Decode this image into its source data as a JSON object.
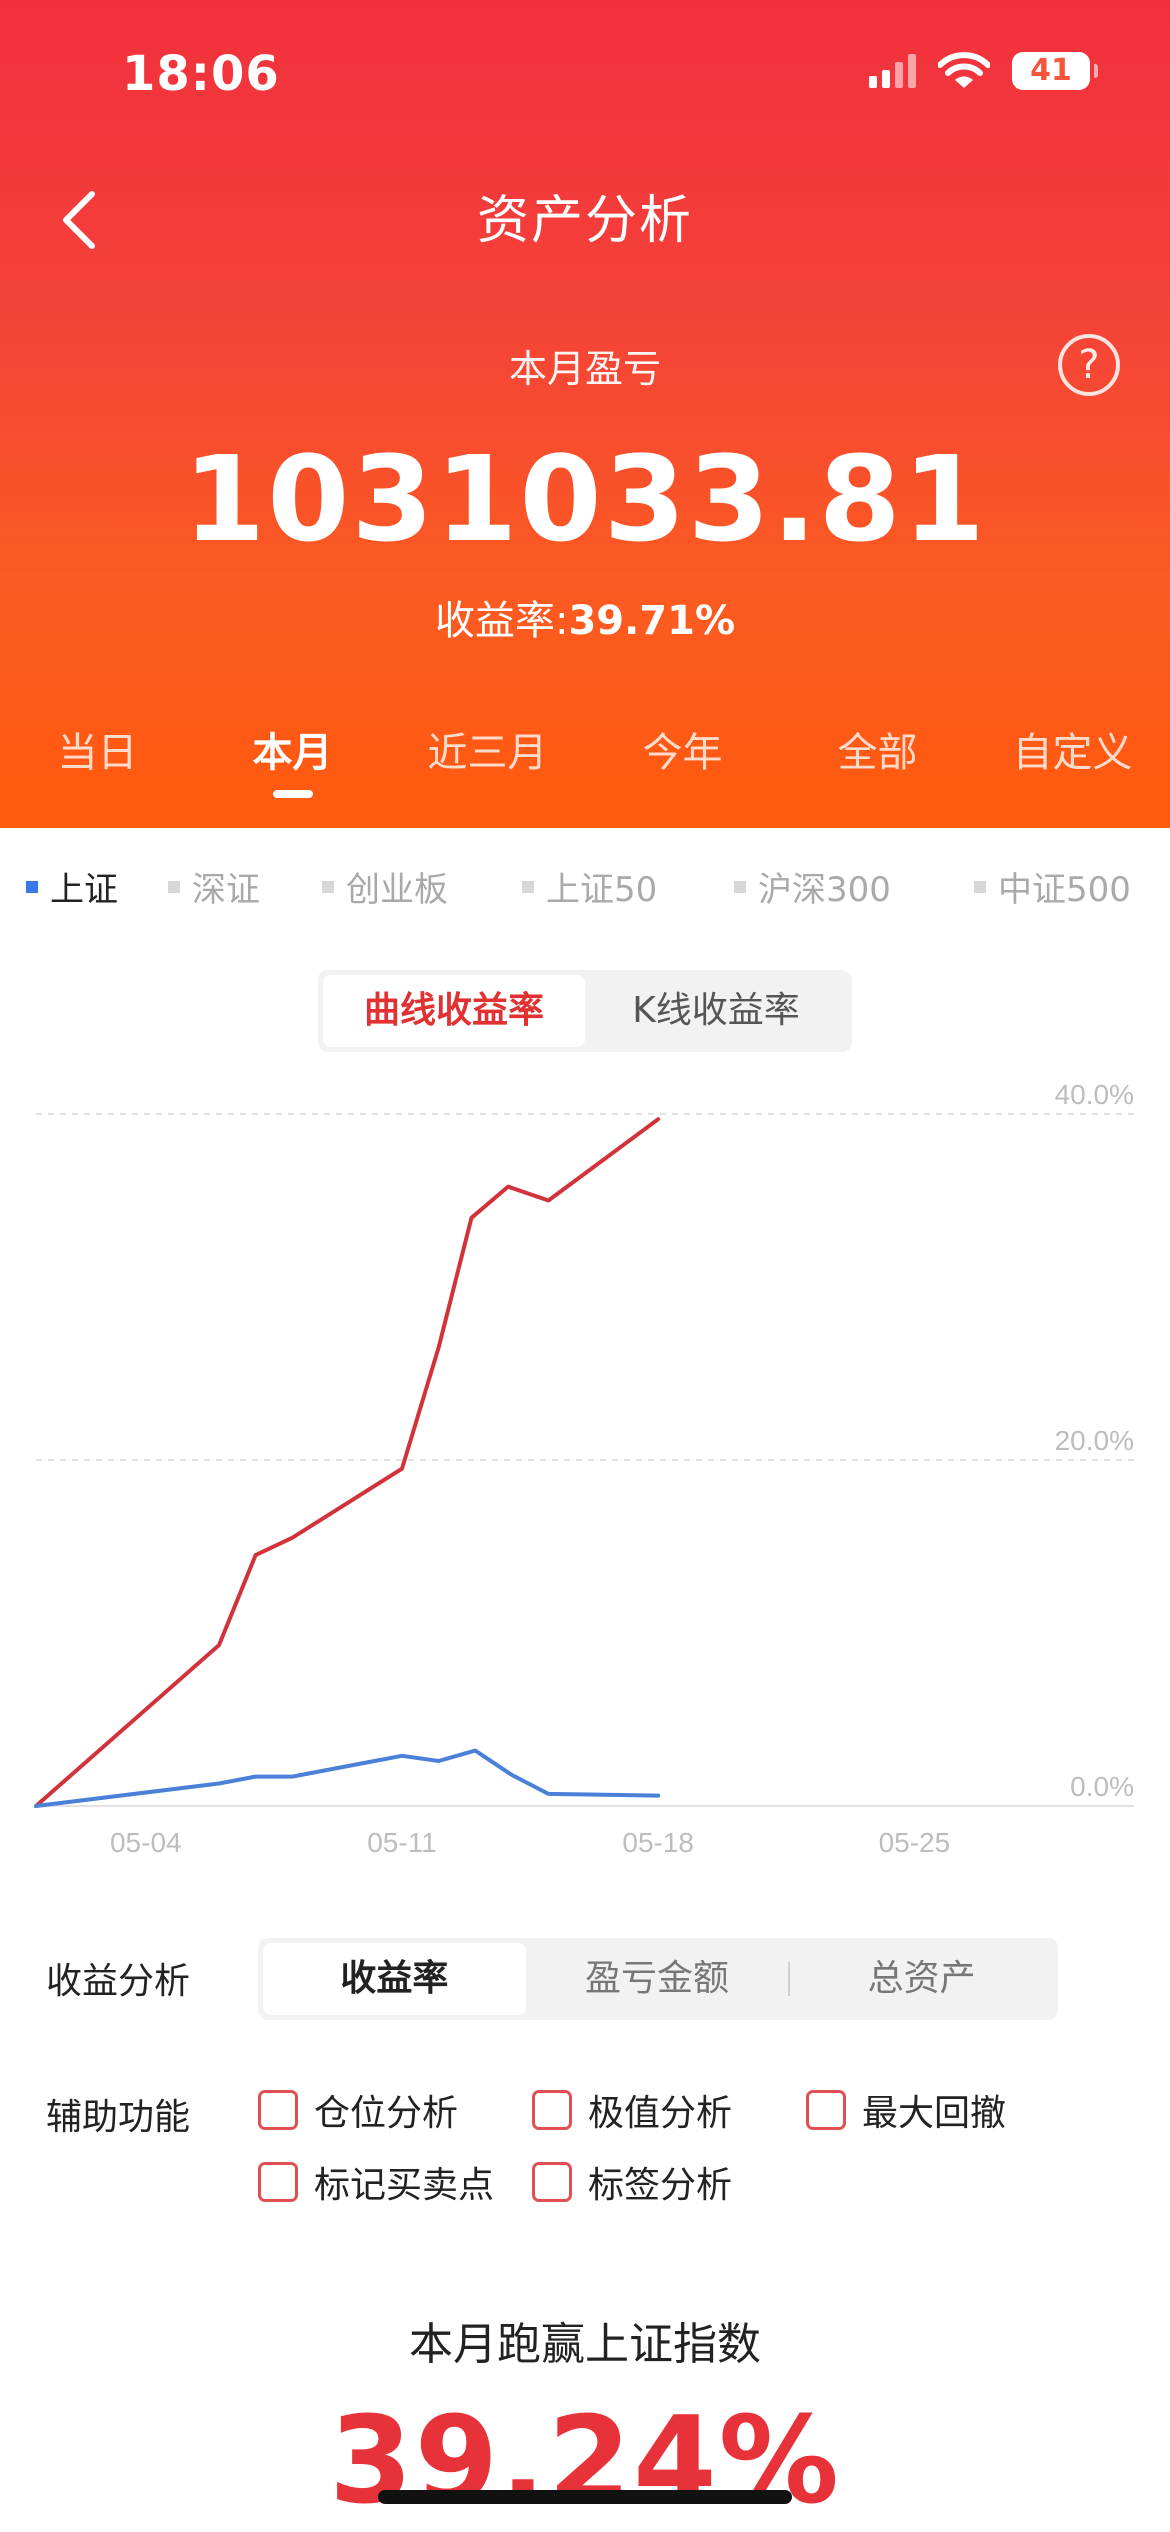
{
  "status_bar": {
    "time": "18:06",
    "battery": "41"
  },
  "header": {
    "title": "资产分析",
    "back_icon": "chevron-left-icon",
    "help_icon": "question-circle-icon"
  },
  "summary": {
    "label": "本月盈亏",
    "value": "1031033.81",
    "rate_label": "收益率:",
    "rate_value": "39.71%"
  },
  "period_tabs": [
    {
      "label": "当日"
    },
    {
      "label": "本月"
    },
    {
      "label": "近三月"
    },
    {
      "label": "今年"
    },
    {
      "label": "全部"
    },
    {
      "label": "自定义"
    }
  ],
  "active_period": "本月",
  "indices": [
    {
      "label": "上证"
    },
    {
      "label": "深证"
    },
    {
      "label": "创业板"
    },
    {
      "label": "上证50"
    },
    {
      "label": "沪深300"
    },
    {
      "label": "中证500"
    }
  ],
  "active_index": "上证",
  "chart_toggle": [
    {
      "label": "曲线收益率"
    },
    {
      "label": "K线收益率"
    }
  ],
  "colors": {
    "portfolio_line": "#d2333b",
    "index_line": "#4a80d8",
    "accent_red": "#e8323a"
  },
  "chart_data": {
    "type": "line",
    "x_domain": [
      1,
      31
    ],
    "x_ticks": [
      {
        "x": 4,
        "label": "05-04"
      },
      {
        "x": 11,
        "label": "05-11"
      },
      {
        "x": 18,
        "label": "05-18"
      },
      {
        "x": 25,
        "label": "05-25"
      }
    ],
    "ylim": [
      0,
      40
    ],
    "y_ticks": [
      {
        "value": 0,
        "label": "0.0%"
      },
      {
        "value": 20,
        "label": "20.0%"
      },
      {
        "value": 40,
        "label": "40.0%"
      }
    ],
    "grid": true,
    "series": [
      {
        "color": "#d2333b",
        "points": [
          [
            1,
            0
          ],
          [
            6,
            9.3
          ],
          [
            7,
            14.5
          ],
          [
            8,
            15.5
          ],
          [
            11,
            19.5
          ],
          [
            12,
            26.5
          ],
          [
            12.9,
            34
          ],
          [
            13.9,
            35.8
          ],
          [
            15,
            35
          ],
          [
            18,
            39.7
          ]
        ]
      },
      {
        "color": "#4a80d8",
        "points": [
          [
            1,
            0
          ],
          [
            6,
            1.3
          ],
          [
            7,
            1.7
          ],
          [
            8,
            1.7
          ],
          [
            11,
            2.9
          ],
          [
            12,
            2.6
          ],
          [
            13,
            3.2
          ],
          [
            14,
            1.8
          ],
          [
            15,
            0.7
          ],
          [
            18,
            0.6
          ]
        ]
      }
    ]
  },
  "analysis": {
    "label": "收益分析",
    "tabs": [
      {
        "label": "收益率"
      },
      {
        "label": "盈亏金额"
      },
      {
        "label": "总资产"
      }
    ]
  },
  "aux": {
    "label": "辅助功能",
    "options": [
      {
        "label": "仓位分析"
      },
      {
        "label": "极值分析"
      },
      {
        "label": "最大回撤"
      },
      {
        "label": "标记买卖点"
      },
      {
        "label": "标签分析"
      }
    ]
  },
  "beat": {
    "title": "本月跑赢上证指数",
    "value": "39.24%"
  }
}
